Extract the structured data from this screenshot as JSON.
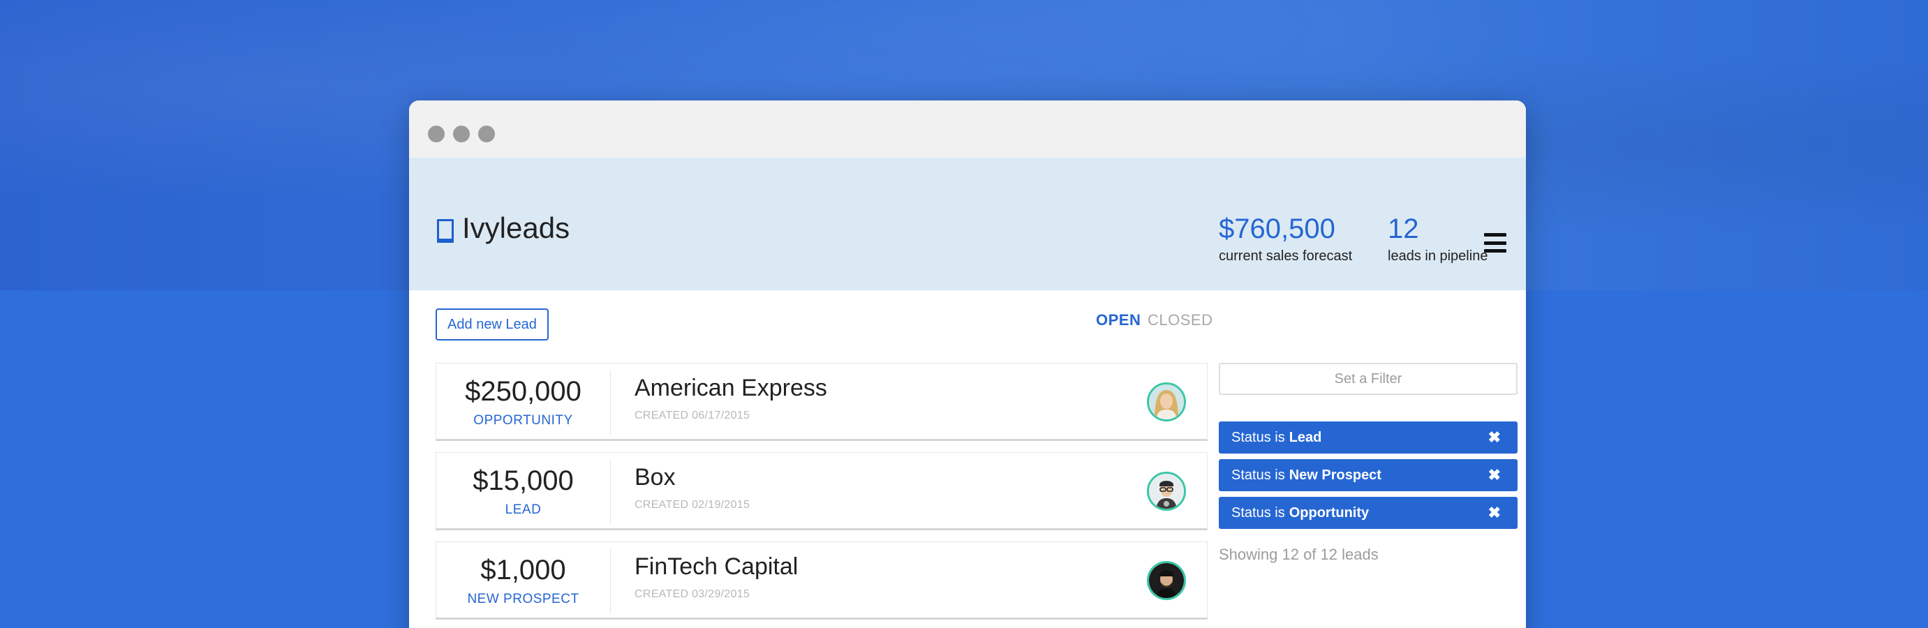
{
  "app": {
    "brand": "Ivyleads",
    "window_controls": [
      "close",
      "minimize",
      "maximize"
    ]
  },
  "header": {
    "forecast_value": "$760,500",
    "forecast_label": "current sales forecast",
    "pipeline_value": "12",
    "pipeline_label": "leads in pipeline",
    "menu_icon": "hamburger-menu-icon"
  },
  "toolbar": {
    "add_label": "Add new Lead",
    "tabs": [
      {
        "label": "OPEN",
        "active": true
      },
      {
        "label": "CLOSED",
        "active": false
      }
    ]
  },
  "leads": [
    {
      "amount": "$250,000",
      "status": "OPPORTUNITY",
      "name": "American Express",
      "created": "CREATED 06/17/2015",
      "avatar": "female-blonde"
    },
    {
      "amount": "$15,000",
      "status": "LEAD",
      "name": "Box",
      "created": "CREATED 02/19/2015",
      "avatar": "male-glasses"
    },
    {
      "amount": "$1,000",
      "status": "NEW PROSPECT",
      "name": "FinTech Capital",
      "created": "CREATED 03/29/2015",
      "avatar": "male-dark"
    }
  ],
  "filters": {
    "placeholder": "Set a Filter",
    "chips": [
      {
        "prefix": "Status is",
        "value": "Lead"
      },
      {
        "prefix": "Status is",
        "value": "New Prospect"
      },
      {
        "prefix": "Status is",
        "value": "Opportunity"
      }
    ],
    "close_glyph": "✖",
    "summary": "Showing 12 of 12 leads"
  },
  "colors": {
    "accent": "#2566d3",
    "header_bg": "#dbe9f4",
    "page_bg": "#2f6fdc",
    "avatar_ring": "#3cc6a7"
  }
}
